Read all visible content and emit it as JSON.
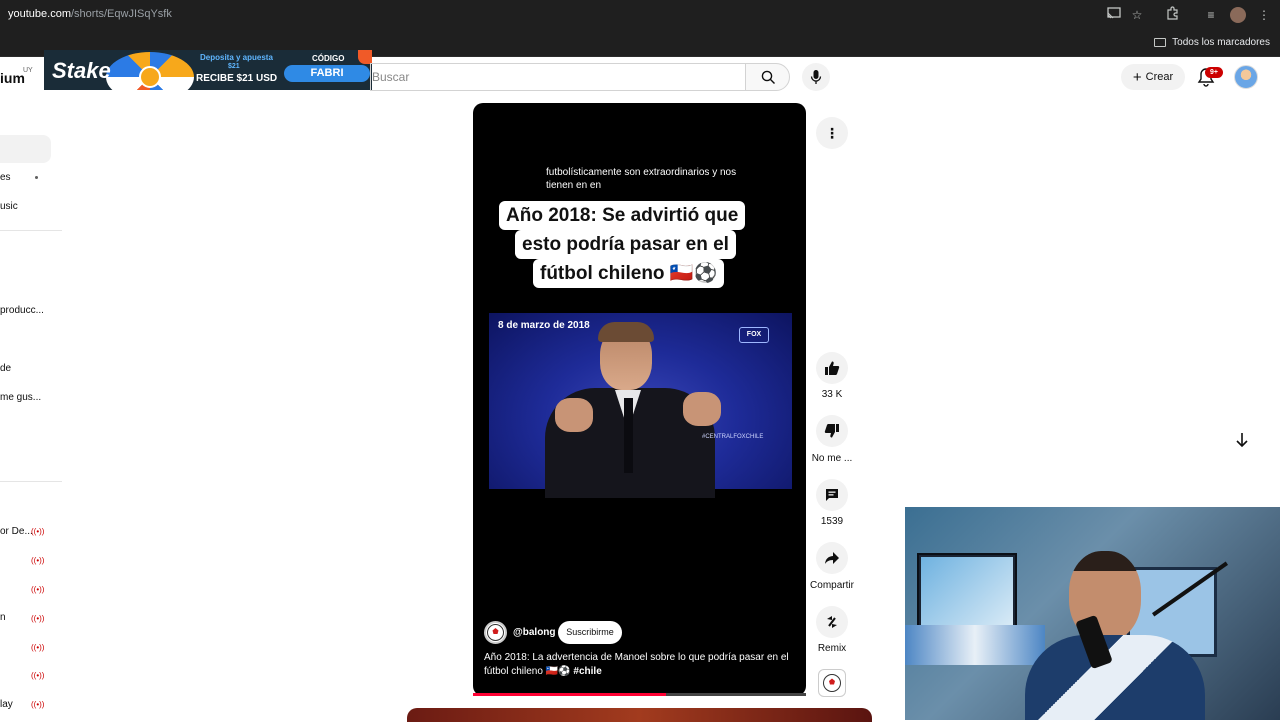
{
  "browser": {
    "url_host": "youtube.com",
    "url_path": "/shorts/EqwJISqYsfk",
    "bookmarks_all": "Todos los marcadores"
  },
  "header": {
    "logo_fragment": "ium",
    "logo_country": "UY",
    "search_placeholder": "Buscar",
    "create_label": "Crear",
    "notifications_badge": "9+"
  },
  "ad": {
    "brand": "Stake",
    "deposit_text": "Deposita y apuesta",
    "deposit_amount": "$21",
    "receive_text": "RECIBE $21 USD",
    "code_label": "CÓDIGO",
    "code": "FABRI"
  },
  "sidebar": {
    "items": [
      {
        "label": "es"
      },
      {
        "label": "usic"
      },
      {
        "label": "producc..."
      },
      {
        "label": "de"
      },
      {
        "label": "me gus..."
      }
    ],
    "live_items": [
      {
        "label": "or De..."
      },
      {
        "label": ""
      },
      {
        "label": ""
      },
      {
        "label": "n"
      },
      {
        "label": ""
      },
      {
        "label": ""
      },
      {
        "label": "lay"
      }
    ]
  },
  "short": {
    "caption_small": "futbolísticamente son extraordinarios y nos tienen en en",
    "title_lines": [
      "Año 2018: Se advirtió que",
      "esto podría pasar en el",
      "fútbol chileno 🇨🇱⚽"
    ],
    "clip_date": "8 de marzo de 2018",
    "clip_logo": "FOX",
    "clip_tag": "#CENTRALFOXCHILE",
    "channel": "@balong",
    "subscribe_label": "Suscribirme",
    "description": "Año 2018: La advertencia de Manoel sobre lo que podría pasar en el fútbol chileno 🇨🇱⚽",
    "description_tag": "#chile",
    "progress": 0.58
  },
  "actions": {
    "likes": "33 K",
    "dislike_label": "No me ...",
    "comments": "1539",
    "share_label": "Compartir",
    "remix_label": "Remix"
  },
  "colors": {
    "accent_red": "#ff0033",
    "badge_red": "#cc0000",
    "chrome_dark": "#1f1f1f"
  }
}
